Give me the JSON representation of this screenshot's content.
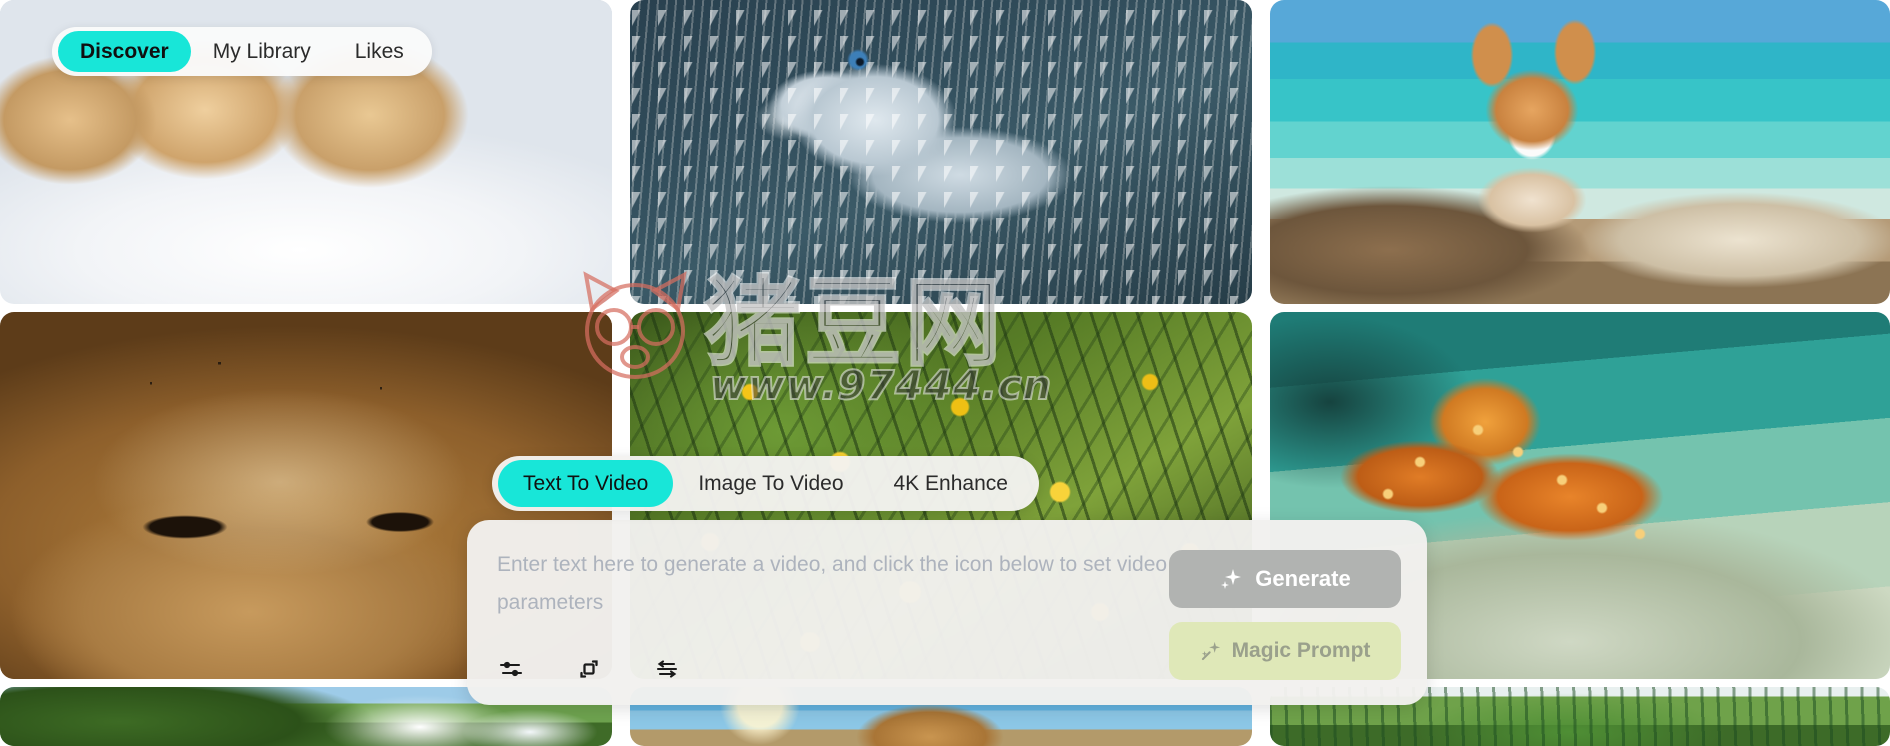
{
  "top_nav": {
    "tabs": [
      {
        "label": "Discover",
        "active": true
      },
      {
        "label": "My Library",
        "active": false
      },
      {
        "label": "Likes",
        "active": false
      }
    ]
  },
  "mode_tabs": {
    "tabs": [
      {
        "label": "Text To Video",
        "active": true
      },
      {
        "label": "Image To Video",
        "active": false
      },
      {
        "label": "4K Enhance",
        "active": false
      }
    ]
  },
  "prompt_panel": {
    "input_value": "",
    "placeholder": "Enter text here to generate a video, and click the icon below to set video parameters",
    "generate_label": "Generate",
    "magic_prompt_label": "Magic Prompt",
    "tools": [
      {
        "name": "settings-sliders-icon",
        "title": "Video settings"
      },
      {
        "name": "aspect-ratio-icon",
        "title": "Aspect ratio"
      },
      {
        "name": "motion-icon",
        "title": "Motion strength"
      }
    ]
  },
  "watermark": {
    "text_cn": "猪豆网",
    "url": "www.97444.cn"
  },
  "gallery": {
    "tiles": [
      {
        "name": "tile-puppies-in-snow",
        "alt": "Golden retriever puppies in snow"
      },
      {
        "name": "tile-ice-dragon",
        "alt": "White scaled dragon head"
      },
      {
        "name": "tile-corgi-beach",
        "alt": "Corgi on a tropical beach"
      },
      {
        "name": "tile-coffee-ships",
        "alt": "Pirate ships sailing in a coffee cup"
      },
      {
        "name": "tile-yellow-flowers",
        "alt": "Yellow flowers and foliage"
      },
      {
        "name": "tile-octopus-reef",
        "alt": "Orange octopus in shallow water"
      },
      {
        "name": "tile-waterfall",
        "alt": "Forest waterfall landscape"
      },
      {
        "name": "tile-lion-sunlight",
        "alt": "Animal in sunlight under blue sky"
      },
      {
        "name": "tile-aquatic-plants",
        "alt": "Green aquatic plants in a glass"
      }
    ]
  },
  "colors": {
    "accent_teal": "#18e6d8",
    "generate_bg": "#b1b3b1",
    "magic_bg": "#dfe8b8",
    "panel_bg": "#f2f1ee",
    "placeholder_text": "#adb3bd"
  }
}
